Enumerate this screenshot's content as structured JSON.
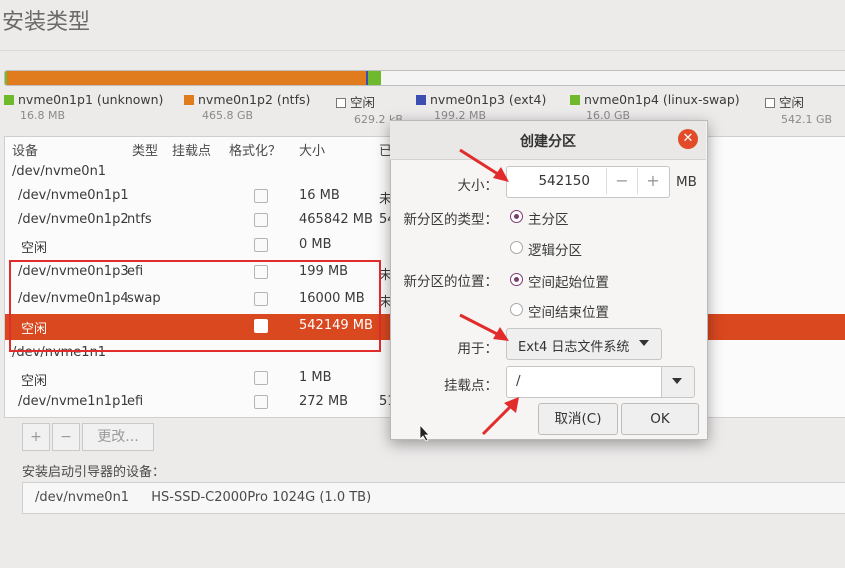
{
  "page": {
    "title": "安装类型"
  },
  "colors": {
    "orange": "#e07b1e",
    "green": "#6fba2c",
    "blue": "#3c4fb0",
    "accent_red": "#d9481f",
    "annot_red": "#e22c2c"
  },
  "legend": [
    {
      "name": "nvme0n1p1 (unknown)",
      "size": "16.8 MB",
      "color": "#6fba2c"
    },
    {
      "name": "nvme0n1p2 (ntfs)",
      "size": "465.8 GB",
      "color": "#e07b1e"
    },
    {
      "name": "空闲",
      "size": "629.2 kB",
      "color": "box"
    },
    {
      "name": "nvme0n1p3 (ext4)",
      "size": "199.2 MB",
      "color": "#3c4fb0"
    },
    {
      "name": "nvme0n1p4 (linux-swap)",
      "size": "16.0 GB",
      "color": "#6fba2c"
    },
    {
      "name": "空闲",
      "size": "542.1 GB",
      "color": "box"
    }
  ],
  "bar": {
    "fractions": [
      0.0,
      0.4295,
      0.0,
      0.0002,
      0.0148,
      0.5555
    ]
  },
  "table": {
    "headers": {
      "device": "设备",
      "type": "类型",
      "mount": "挂载点",
      "format": "格式化？",
      "size": "大小",
      "used": "已"
    },
    "rows": [
      {
        "device": "/dev/nvme0n1",
        "type": "",
        "format": false,
        "size": "",
        "used": "",
        "group": true
      },
      {
        "device": "/dev/nvme0n1p1",
        "type": "",
        "format": true,
        "size": "16 MB",
        "used": "未"
      },
      {
        "device": "/dev/nvme0n1p2",
        "type": "ntfs",
        "format": true,
        "size": "465842 MB",
        "used": "54"
      },
      {
        "device": "空闲",
        "type": "",
        "format": true,
        "size": "0 MB",
        "used": ""
      },
      {
        "device": "/dev/nvme0n1p3",
        "type": "efi",
        "format": true,
        "size": "199 MB",
        "used": "未"
      },
      {
        "device": "/dev/nvme0n1p4",
        "type": "swap",
        "format": true,
        "size": "16000 MB",
        "used": "未"
      },
      {
        "device": "空闲",
        "type": "",
        "format": true,
        "size": "542149 MB",
        "used": "",
        "selected": true
      },
      {
        "device": "/dev/nvme1n1",
        "type": "",
        "format": false,
        "size": "",
        "used": "",
        "group": true
      },
      {
        "device": "空闲",
        "type": "",
        "format": true,
        "size": "1 MB",
        "used": ""
      },
      {
        "device": "/dev/nvme1n1p1",
        "type": "efi",
        "format": true,
        "size": "272 MB",
        "used": "51"
      }
    ],
    "toolbar": {
      "add": "+",
      "remove": "−",
      "change": "更改..."
    }
  },
  "boot": {
    "label": "安装启动引导器的设备：",
    "device": "/dev/nvme0n1",
    "model": "HS-SSD-C2000Pro 1024G (1.0 TB)"
  },
  "dialog": {
    "title": "创建分区",
    "close": "✕",
    "size_label": "大小：",
    "size_value": "542150",
    "size_minus": "−",
    "size_plus": "+",
    "size_unit": "MB",
    "type_label": "新分区的类型：",
    "type_primary": "主分区",
    "type_logical": "逻辑分区",
    "location_label": "新分区的位置：",
    "location_start": "空间起始位置",
    "location_end": "空间结束位置",
    "use_label": "用于：",
    "use_value": "Ext4 日志文件系统",
    "mount_label": "挂载点：",
    "mount_value": "/",
    "cancel": "取消(C)",
    "ok": "OK"
  }
}
